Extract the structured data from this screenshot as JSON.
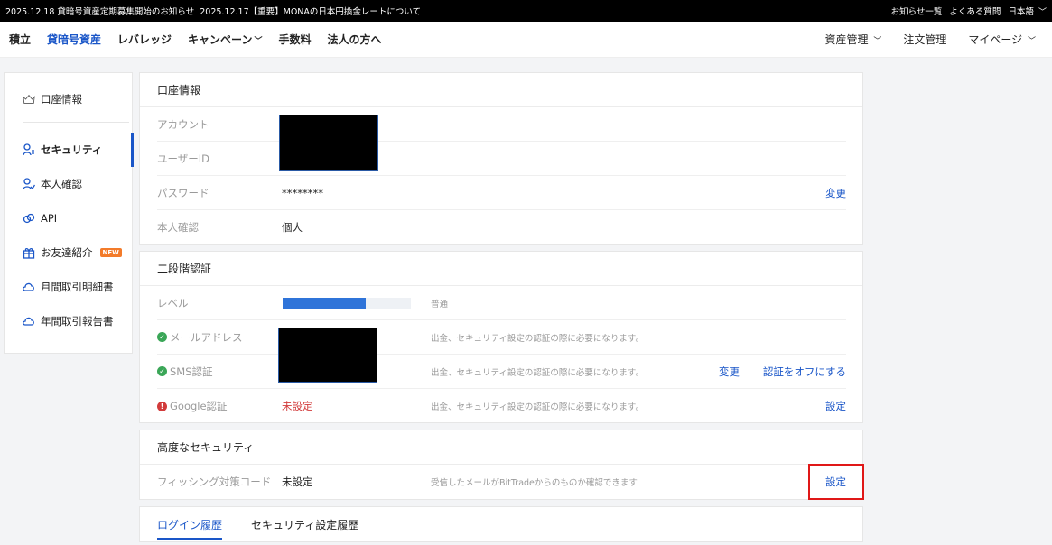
{
  "topbar": {
    "news1": "2025.12.18 貸暗号資産定期募集開始のお知らせ",
    "news2": "2025.12.17【重要】MONAの日本円換金レートについて",
    "notices": "お知らせ一覧",
    "faq": "よくある質問",
    "language": "日本語"
  },
  "nav": {
    "items": [
      "積立",
      "貸暗号資産",
      "レバレッジ",
      "キャンペーン",
      "手数料",
      "法人の方へ"
    ],
    "right": [
      "資産管理",
      "注文管理",
      "マイページ"
    ]
  },
  "sidebar": {
    "account_info": "口座情報",
    "items": [
      {
        "label": "セキュリティ",
        "icon": "user-shield-icon"
      },
      {
        "label": "本人確認",
        "icon": "user-check-icon"
      },
      {
        "label": "API",
        "icon": "link-icon"
      },
      {
        "label": "お友達紹介",
        "icon": "gift-icon"
      },
      {
        "label": "月間取引明細書",
        "icon": "cloud-icon"
      },
      {
        "label": "年間取引報告書",
        "icon": "cloud-icon"
      }
    ],
    "new_badge": "NEW"
  },
  "account": {
    "title": "口座情報",
    "account_label": "アカウント",
    "userid_label": "ユーザーID",
    "password_label": "パスワード",
    "password_value": "********",
    "password_action": "変更",
    "kyc_label": "本人確認",
    "kyc_value": "個人"
  },
  "twofa": {
    "title": "二段階認証",
    "level_label": "レベル",
    "level_value": 0.65,
    "level_text": "普通",
    "email_label": "メールアドレス",
    "email_desc": "出金、セキュリティ設定の認証の際に必要になります。",
    "sms_label": "SMS認証",
    "sms_desc": "出金、セキュリティ設定の認証の際に必要になります。",
    "sms_change": "変更",
    "sms_off": "認証をオフにする",
    "google_label": "Google認証",
    "google_status": "未設定",
    "google_desc": "出金、セキュリティ設定の認証の際に必要になります。",
    "google_action": "設定"
  },
  "advanced": {
    "title": "高度なセキュリティ",
    "phishing_label": "フィッシング対策コード",
    "phishing_value": "未設定",
    "phishing_desc": "受信したメールがBitTradeからのものか確認できます",
    "phishing_action": "設定"
  },
  "history_tabs": [
    "ログイン履歴",
    "セキュリティ設定履歴"
  ],
  "colors": {
    "accent": "#1a56c8",
    "warning": "#d23b3b",
    "ok": "#3aa657",
    "highlight": "#e01818"
  }
}
